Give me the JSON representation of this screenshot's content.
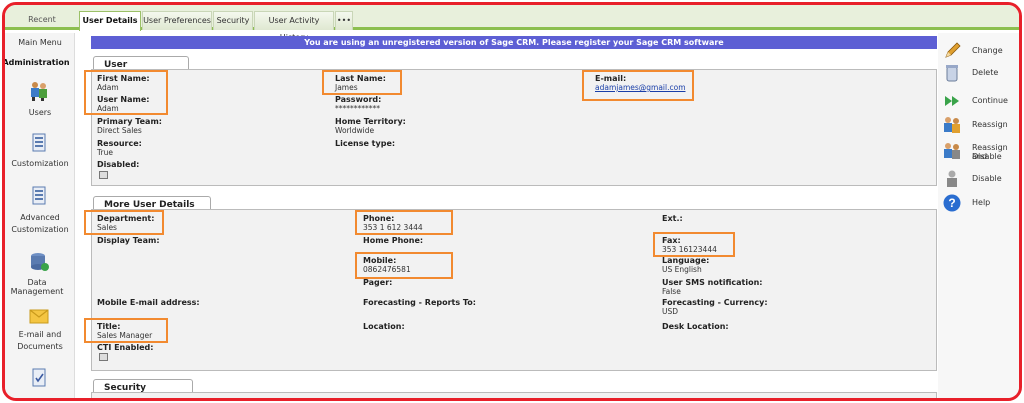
{
  "tabs": {
    "recent": "Recent",
    "user_details": "User Details",
    "user_preferences": "User Preferences",
    "security": "Security",
    "user_activity_history": "User Activity History",
    "more": "•••"
  },
  "leftnav": {
    "main_menu": "Main Menu",
    "administration": "Administration",
    "users": "Users",
    "customization": "Customization",
    "advanced_line1": "Advanced",
    "advanced_line2": "Customization",
    "data_management": "Data Management",
    "email_line1": "E-mail and",
    "email_line2": "Documents"
  },
  "banner": "You are using an unregistered version of Sage CRM. Please register your Sage CRM software",
  "user_panel": {
    "title": "User",
    "first_name_label": "First Name:",
    "first_name": "Adam",
    "last_name_label": "Last Name:",
    "last_name": "James",
    "email_label": "E-mail:",
    "email": "adamjames@gmail.com",
    "user_name_label": "User Name:",
    "user_name": "Adam",
    "password_label": "Password:",
    "password": "************",
    "primary_team_label": "Primary Team:",
    "primary_team": "Direct Sales",
    "home_territory_label": "Home Territory:",
    "home_territory": "Worldwide",
    "resource_label": "Resource:",
    "resource": "True",
    "license_type_label": "License type:",
    "disabled_label": "Disabled:"
  },
  "more_panel": {
    "title": "More User Details",
    "department_label": "Department:",
    "department": "Sales",
    "phone_label": "Phone:",
    "phone": "353 1 612 3444",
    "ext_label": "Ext.:",
    "display_team_label": "Display Team:",
    "home_phone_label": "Home Phone:",
    "fax_label": "Fax:",
    "fax": "353 16123444",
    "mobile_label": "Mobile:",
    "mobile": "0862476581",
    "language_label": "Language:",
    "language": "US English",
    "pager_label": "Pager:",
    "sms_label": "User SMS notification:",
    "sms": "False",
    "mobile_email_label": "Mobile E-mail address:",
    "forecast_reports_label": "Forecasting - Reports To:",
    "forecast_currency_label": "Forecasting - Currency:",
    "forecast_currency": "USD",
    "title_label": "Title:",
    "title_value": "Sales Manager",
    "location_label": "Location:",
    "desk_location_label": "Desk Location:",
    "cti_label": "CTI Enabled:"
  },
  "security_panel": {
    "title": "Security"
  },
  "actions": {
    "change": "Change",
    "delete": "Delete",
    "continue": "Continue",
    "reassign": "Reassign",
    "reassign_disable_1": "Reassign and",
    "reassign_disable_2": "Disable",
    "disable": "Disable",
    "help": "Help"
  },
  "colors": {
    "tab_accent": "#8cbf4f",
    "banner_bg": "#5d5fd4",
    "highlight": "#f28a30",
    "frame": "#e8202a"
  }
}
